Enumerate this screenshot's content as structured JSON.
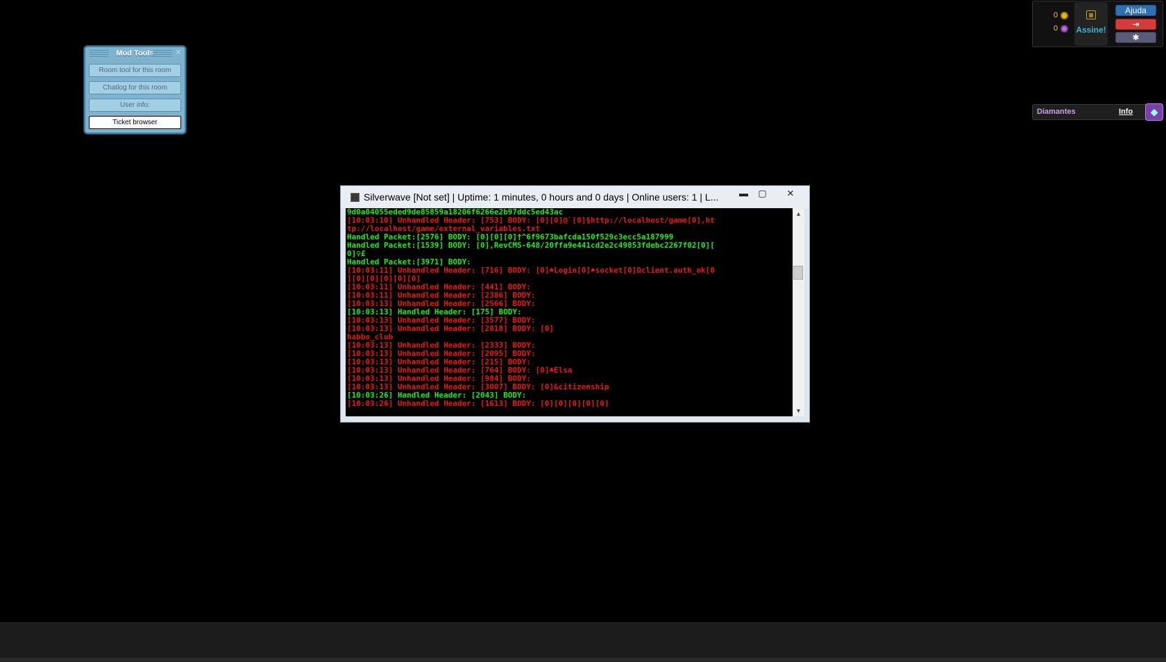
{
  "mod_tools": {
    "title": "Mod Tools",
    "buttons": [
      "Room tool for this room",
      "Chatlog for this room",
      "User info:",
      "Ticket browser"
    ]
  },
  "hud": {
    "credits": "0",
    "duckets": "0",
    "subscribe": "Assine!",
    "help": "Ajuda"
  },
  "diamonds": {
    "label": "Diamantes",
    "info": "Info"
  },
  "console_window": {
    "title": "Silverwave [Not set] | Uptime: 1 minutes, 0 hours and 0 days | Online users: 1 | L...",
    "lines": [
      {
        "c": "g",
        "t": "9d0a04055eded9de85859a18206f6266e2b97ddc5ed43ac"
      },
      {
        "c": "r",
        "t": "[10:03:10] Unhandled Header: [753] BODY: [0][0]@`[0]§http://localhost/game[0],ht"
      },
      {
        "c": "r",
        "t": "tp://localhost/game/external_variables.txt"
      },
      {
        "c": "g",
        "t": "Handled Packet:[2576] BODY: [0][0][0]†^6f9673bafcda150f529c3ecc5a187999"
      },
      {
        "c": "g",
        "t": "Handled Packet:[1539] BODY: [0],RevCMS-648/20ffa9e441cd2e2c49853fdebc2267f02[0]["
      },
      {
        "c": "g",
        "t": "0]♀£"
      },
      {
        "c": "g",
        "t": "Handled Packet:[3971] BODY:"
      },
      {
        "c": "r",
        "t": "[10:03:11] Unhandled Header: [716] BODY: [0]♠Login[0]♠socket[0]Ωclient.auth_ok[0"
      },
      {
        "c": "r",
        "t": "][0][0][0][0][0]"
      },
      {
        "c": "r",
        "t": "[10:03:11] Unhandled Header: [441] BODY:"
      },
      {
        "c": "r",
        "t": "[10:03:11] Unhandled Header: [2386] BODY:"
      },
      {
        "c": "r",
        "t": "[10:03:13] Unhandled Header: [2566] BODY:"
      },
      {
        "c": "g",
        "t": "[10:03:13] Handled Header: [175] BODY:"
      },
      {
        "c": "r",
        "t": "[10:03:13] Unhandled Header: [3577] BODY:"
      },
      {
        "c": "r",
        "t": "[10:03:13] Unhandled Header: [2818] BODY: [0]"
      },
      {
        "c": "r",
        "t": "habbo_club"
      },
      {
        "c": "r",
        "t": "[10:03:13] Unhandled Header: [2333] BODY:"
      },
      {
        "c": "r",
        "t": "[10:03:13] Unhandled Header: [2095] BODY:"
      },
      {
        "c": "r",
        "t": "[10:03:13] Unhandled Header: [215] BODY:"
      },
      {
        "c": "r",
        "t": "[10:03:13] Unhandled Header: [764] BODY: [0]♣Elsa"
      },
      {
        "c": "r",
        "t": "[10:03:13] Unhandled Header: [984] BODY:"
      },
      {
        "c": "r",
        "t": "[10:03:13] Unhandled Header: [3007] BODY: [0]&citizenship"
      },
      {
        "c": "g",
        "t": "[10:03:26] Handled Header: [2043] BODY:"
      },
      {
        "c": "r",
        "t": "[10:03:26] Unhandled Header: [1613] BODY: [0][0][0][0][0]"
      }
    ]
  },
  "colors": {
    "console_green": "#16f016",
    "console_red": "#f01414",
    "mod_panel": "#7fb2cc"
  }
}
